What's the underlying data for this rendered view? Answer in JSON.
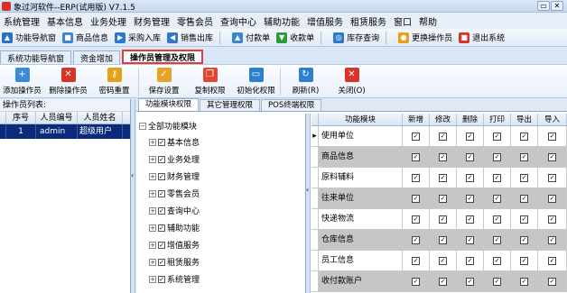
{
  "window": {
    "title": "象过河软件--ERP(试用版) V7.1.5",
    "min_glyph": "▭",
    "close_glyph": "✕"
  },
  "menu": [
    "系统管理",
    "基本信息",
    "业务处理",
    "财务管理",
    "零售会员",
    "查询中心",
    "辅助功能",
    "增值服务",
    "租赁服务",
    "窗口",
    "帮助"
  ],
  "toolbar": [
    {
      "label": "功能导航窗",
      "icon": "home-icon",
      "glyph": "▲",
      "color": "#2a6ec6"
    },
    {
      "label": "商品信息",
      "icon": "goods-icon",
      "glyph": "■",
      "color": "#3a86d1"
    },
    {
      "label": "采购入库",
      "icon": "purchase-icon",
      "glyph": "▶",
      "color": "#2f78c8"
    },
    {
      "label": "销售出库",
      "icon": "sales-icon",
      "glyph": "◀",
      "color": "#2f78c8"
    },
    {
      "label": "付款单",
      "icon": "payment-icon",
      "glyph": "▲",
      "color": "#3a86d1"
    },
    {
      "label": "收款单",
      "icon": "receipt-icon",
      "glyph": "▼",
      "color": "#2c9a3c"
    },
    {
      "label": "库存查询",
      "icon": "stock-search-icon",
      "glyph": "◎",
      "color": "#2f78c8"
    },
    {
      "label": "更换操作员",
      "icon": "switch-user-icon",
      "glyph": "●",
      "color": "#e8a11c"
    },
    {
      "label": "退出系统",
      "icon": "exit-icon",
      "glyph": "■",
      "color": "#d8342b"
    }
  ],
  "nav_tabs": [
    "系统功能导航窗",
    "资金增加",
    "操作员管理及权限"
  ],
  "actions": [
    {
      "label": "添加操作员",
      "icon": "add-user-icon",
      "glyph": "+",
      "color": "#3c8bd6"
    },
    {
      "label": "删除操作员",
      "icon": "delete-user-icon",
      "glyph": "✕",
      "color": "#d8342b"
    },
    {
      "label": "密码重置",
      "icon": "key-icon",
      "glyph": "⚷",
      "color": "#e3a21a"
    },
    {
      "label": "保存设置",
      "icon": "save-icon",
      "glyph": "✓",
      "color": "#e6a324"
    },
    {
      "label": "复制权限",
      "icon": "copy-icon",
      "glyph": "❐",
      "color": "#e1462e"
    },
    {
      "label": "初始化权限",
      "icon": "init-icon",
      "glyph": "▭",
      "color": "#2f7fd0"
    },
    {
      "label": "刷新(R)",
      "icon": "refresh-icon",
      "glyph": "↻",
      "color": "#2f7fd0"
    },
    {
      "label": "关闭(O)",
      "icon": "close-icon",
      "glyph": "✕",
      "color": "#d8342b"
    }
  ],
  "operators": {
    "title": "操作员列表:",
    "columns": [
      "序号",
      "人员编号",
      "人员姓名"
    ],
    "rows": [
      {
        "seq": "1",
        "code": "admin",
        "name": "超级用户"
      }
    ]
  },
  "sub_tabs": [
    "功能模块权限",
    "其它管理权限",
    "POS终端权限"
  ],
  "tree": {
    "root": "全部功能模块",
    "items": [
      "基本信息",
      "业务处理",
      "财务管理",
      "零售会员",
      "查询中心",
      "辅助功能",
      "增值服务",
      "租赁服务",
      "系统管理"
    ]
  },
  "permissions": {
    "columns": [
      "功能模块",
      "新增",
      "修改",
      "删除",
      "打印",
      "导出",
      "导入"
    ],
    "rows": [
      "使用单位",
      "商品信息",
      "原料辅料",
      "往来单位",
      "快递物流",
      "仓库信息",
      "员工信息",
      "收付款账户"
    ]
  }
}
